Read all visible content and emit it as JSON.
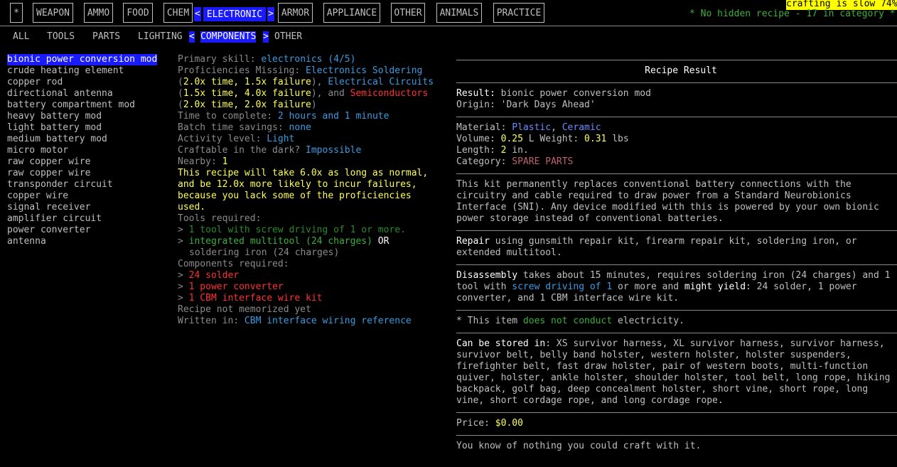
{
  "tabs": {
    "star": "*",
    "weapon": "WEAPON",
    "ammo": "AMMO",
    "food": "FOOD",
    "chem": "CHEM",
    "electronic": "ELECTRONIC",
    "armor": "ARMOR",
    "appliance": "APPLIANCE",
    "other": "OTHER",
    "animals": "ANIMALS",
    "practice": "PRACTICE",
    "left_arrow": "<",
    "right_arrow": ">"
  },
  "status": {
    "crafting_slow": "crafting is slow 74%",
    "hidden_recipe": "* No hidden recipe - 17 in category *"
  },
  "subtabs": {
    "all": "ALL",
    "tools": "TOOLS",
    "parts": "PARTS",
    "lighting": "LIGHTING",
    "components": "COMPONENTS",
    "other": "OTHER",
    "left_arrow": "<",
    "right_arrow": ">"
  },
  "recipes": [
    "bionic power conversion mod",
    "crude heating element",
    "copper rod",
    "directional antenna",
    "battery compartment mod",
    "heavy battery mod",
    "light battery mod",
    "medium battery mod",
    "micro motor",
    "raw copper wire",
    "raw copper wire",
    "transponder circuit",
    "copper wire",
    "signal receiver",
    "amplifier circuit",
    "power converter",
    "antenna"
  ],
  "details": {
    "primary_skill_label": "Primary skill:",
    "primary_skill_value": "electronics (4/5)",
    "prof_missing_label": "Proficiencies Missing:",
    "prof1": "Electronics Soldering",
    "prof1_open": "(",
    "prof1_mult": "2.0x time, 1.5x failure",
    "prof1_close": "),",
    "prof2": "Electrical Circuits",
    "prof2_open": "(",
    "prof2_mult": "1.5x time, 4.0x failure",
    "prof2_close": "), and",
    "prof3": "Semiconductors",
    "prof3_open": "(",
    "prof3_mult": "2.0x time, 2.0x failure",
    "prof3_close": ")",
    "time_label": "Time to complete:",
    "time_value": "2 hours and 1 minute",
    "batch_label": "Batch time savings:",
    "batch_value": "none",
    "activity_label": "Activity level:",
    "activity_value": "Light",
    "dark_label": "Craftable in the dark?",
    "dark_value": "Impossible",
    "nearby_label": "Nearby:",
    "nearby_value": "1",
    "warn1": "This recipe will take 6.0x as long as normal,",
    "warn2": "and be 12.0x more likely to incur failures,",
    "warn3": "because you lack some of the proficiencies",
    "warn4": "used.",
    "tools_label": "Tools required:",
    "tool1_marker": ">",
    "tool1": "1 tool with screw driving of 1 or more.",
    "tool2_marker": ">",
    "tool2": "integrated multitool (24 charges)",
    "tool2_or": "OR",
    "tool2b": "soldering iron (24 charges)",
    "components_label": "Components required:",
    "comp1_marker": ">",
    "comp1": "24 solder",
    "comp2_marker": ">",
    "comp2": "1 power converter",
    "comp3_marker": ">",
    "comp3": "1 CBM interface wire kit",
    "memorized": "Recipe not memorized yet",
    "written_label": "Written in:",
    "written_value": "CBM interface wiring reference"
  },
  "result": {
    "header": "Recipe Result",
    "result_label": "Result:",
    "result_value": "bionic power conversion mod",
    "origin_label": "Origin:",
    "origin_value": "'Dark Days Ahead'",
    "material_label": "Material:",
    "material1": "Plastic",
    "material_sep": ",",
    "material2": "Ceramic",
    "volume_label": "Volume:",
    "volume_value": "0.25",
    "volume_unit": "L",
    "weight_label": "Weight:",
    "weight_value": "0.31",
    "weight_unit": "lbs",
    "length_label": "Length:",
    "length_value": "2",
    "length_unit": "in.",
    "category_label": "Category:",
    "category_value": "SPARE PARTS",
    "description": "This kit permanently replaces conventional battery connections with the circuitry and cable required to draw power from a Standard Neurobionics Interface (SNI).  Any device modified with this is powered by your own bionic power storage instead of conventional batteries.",
    "repair_label": "Repair",
    "repair_text": "using gunsmith repair kit, firearm repair kit, soldering iron, or extended multitool.",
    "disassembly_label": "Disassembly",
    "disassembly_text1": "takes about 15 minutes, requires soldering iron (24 charges) and 1 tool with",
    "disassembly_link": "screw driving of 1",
    "disassembly_text2": "or more and",
    "might_yield": "might yield",
    "disassembly_text3": ": 24 solder, 1 power converter, and 1 CBM interface wire kit.",
    "conduct_prefix": "* This item",
    "conduct_value": "does not conduct",
    "conduct_suffix": "electricity.",
    "stored_label": "Can be stored in",
    "stored_text": ": XS survivor harness, XL survivor harness, survivor harness, survivor belt, belly band holster, western holster, holster suspenders, firefighter belt, fast draw holster, pair of western boots, multi-function quiver, holster, ankle holster, shoulder holster, tool belt, long rope, hiking backpack, golf bag, deep concealment holster, short vine, short rope, long vine, short cordage rope, and long cordage rope.",
    "price_label": "Price:",
    "price_value": "$0.00",
    "craft_with": "You know of nothing you could craft with it."
  }
}
